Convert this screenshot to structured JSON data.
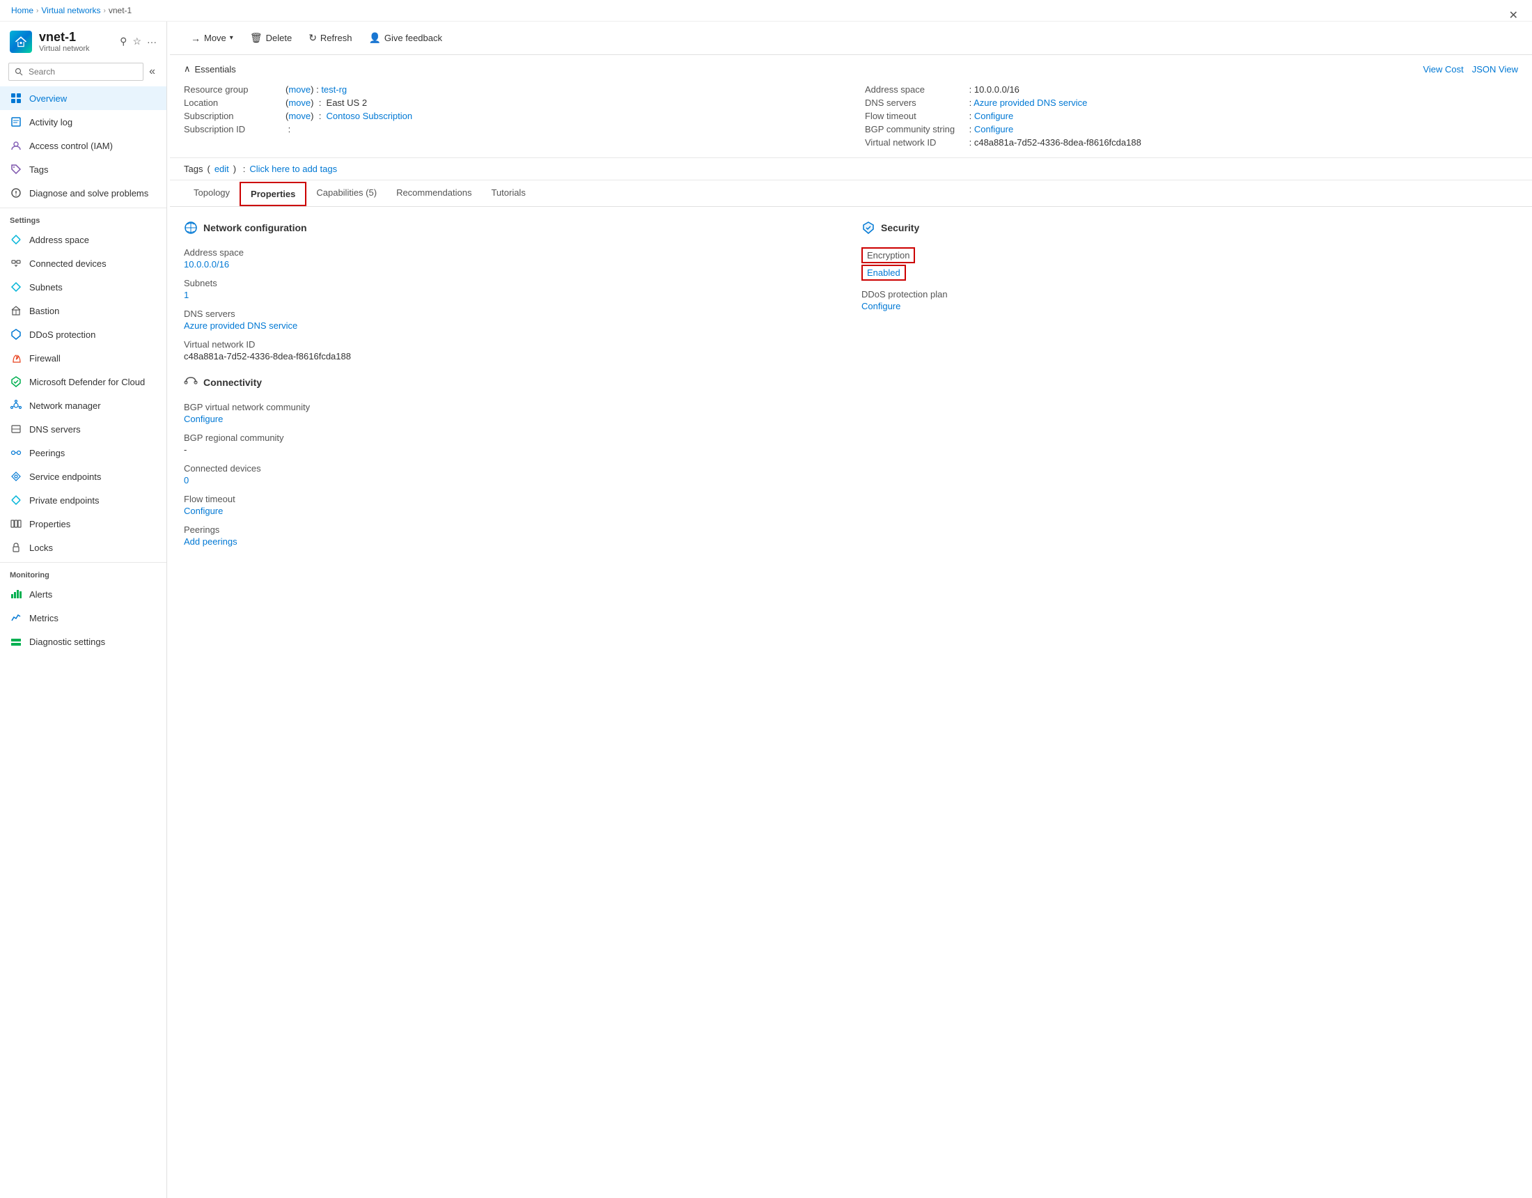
{
  "breadcrumb": {
    "items": [
      "Home",
      "Virtual networks"
    ],
    "current": "vnet-1"
  },
  "resource": {
    "name": "vnet-1",
    "type": "Virtual network"
  },
  "header_icons": {
    "pin": "☆",
    "star": "★",
    "more": "···"
  },
  "search": {
    "placeholder": "Search"
  },
  "toolbar": {
    "move_label": "Move",
    "delete_label": "Delete",
    "refresh_label": "Refresh",
    "feedback_label": "Give feedback"
  },
  "essentials": {
    "title": "Essentials",
    "view_cost": "View Cost",
    "json_view": "JSON View",
    "fields_left": [
      {
        "key": "Resource group",
        "value": "(move) : test-rg",
        "link": "test-rg",
        "move_link": "move"
      },
      {
        "key": "Location",
        "value": "(move)  :  East US 2",
        "has_move": true,
        "display": "East US 2"
      },
      {
        "key": "Subscription",
        "value": "(move)  :  Contoso Subscription",
        "has_move": true,
        "display": "Contoso Subscription"
      },
      {
        "key": "Subscription ID",
        "value": ":"
      }
    ],
    "fields_right": [
      {
        "key": "Address space",
        "value": "10.0.0.0/16"
      },
      {
        "key": "DNS servers",
        "value": "Azure provided DNS service"
      },
      {
        "key": "Flow timeout",
        "value": "Configure"
      },
      {
        "key": "BGP community string",
        "value": "Configure"
      },
      {
        "key": "Virtual network ID",
        "value": "c48a881a-7d52-4336-8dea-f8616fcda188"
      }
    ]
  },
  "tags": {
    "label": "Tags",
    "edit": "edit",
    "add_text": "Click here to add tags"
  },
  "tabs": [
    {
      "label": "Topology",
      "active": false
    },
    {
      "label": "Properties",
      "active": true,
      "highlighted": true
    },
    {
      "label": "Capabilities (5)",
      "active": false
    },
    {
      "label": "Recommendations",
      "active": false
    },
    {
      "label": "Tutorials",
      "active": false
    }
  ],
  "properties": {
    "network_config": {
      "title": "Network configuration",
      "fields": [
        {
          "label": "Address space",
          "value": "10.0.0.0/16",
          "is_link": true
        },
        {
          "label": "Subnets",
          "value": "1",
          "is_link": true
        },
        {
          "label": "DNS servers",
          "value": "Azure provided DNS service",
          "is_link": true
        },
        {
          "label": "Virtual network ID",
          "value": "c48a881a-7d52-4336-8dea-f8616fcda188"
        }
      ]
    },
    "connectivity": {
      "title": "Connectivity",
      "fields": [
        {
          "label": "BGP virtual network community",
          "value": "Configure",
          "is_link": true
        },
        {
          "label": "BGP regional community",
          "value": "-"
        },
        {
          "label": "Connected devices",
          "value": "0",
          "is_link": true
        },
        {
          "label": "Flow timeout",
          "value": "Configure",
          "is_link": true
        },
        {
          "label": "Peerings",
          "value": "Add peerings",
          "is_link": true
        }
      ]
    },
    "security": {
      "title": "Security",
      "fields": [
        {
          "label": "Encryption",
          "value": "Enabled",
          "highlighted": true
        },
        {
          "label": "DDoS protection plan",
          "value": "Configure",
          "is_link": true
        }
      ]
    }
  },
  "sidebar_nav": {
    "main_items": [
      {
        "id": "overview",
        "label": "Overview",
        "active": true
      },
      {
        "id": "activity-log",
        "label": "Activity log"
      },
      {
        "id": "access-control",
        "label": "Access control (IAM)"
      },
      {
        "id": "tags",
        "label": "Tags"
      },
      {
        "id": "diagnose",
        "label": "Diagnose and solve problems"
      }
    ],
    "settings_label": "Settings",
    "settings_items": [
      {
        "id": "address-space",
        "label": "Address space"
      },
      {
        "id": "connected-devices",
        "label": "Connected devices"
      },
      {
        "id": "subnets",
        "label": "Subnets"
      },
      {
        "id": "bastion",
        "label": "Bastion"
      },
      {
        "id": "ddos-protection",
        "label": "DDoS protection"
      },
      {
        "id": "firewall",
        "label": "Firewall"
      },
      {
        "id": "microsoft-defender",
        "label": "Microsoft Defender for Cloud"
      },
      {
        "id": "network-manager",
        "label": "Network manager"
      },
      {
        "id": "dns-servers",
        "label": "DNS servers"
      },
      {
        "id": "peerings",
        "label": "Peerings"
      },
      {
        "id": "service-endpoints",
        "label": "Service endpoints"
      },
      {
        "id": "private-endpoints",
        "label": "Private endpoints"
      },
      {
        "id": "properties",
        "label": "Properties"
      },
      {
        "id": "locks",
        "label": "Locks"
      }
    ],
    "monitoring_label": "Monitoring",
    "monitoring_items": [
      {
        "id": "alerts",
        "label": "Alerts"
      },
      {
        "id": "metrics",
        "label": "Metrics"
      },
      {
        "id": "diagnostic-settings",
        "label": "Diagnostic settings"
      }
    ]
  }
}
